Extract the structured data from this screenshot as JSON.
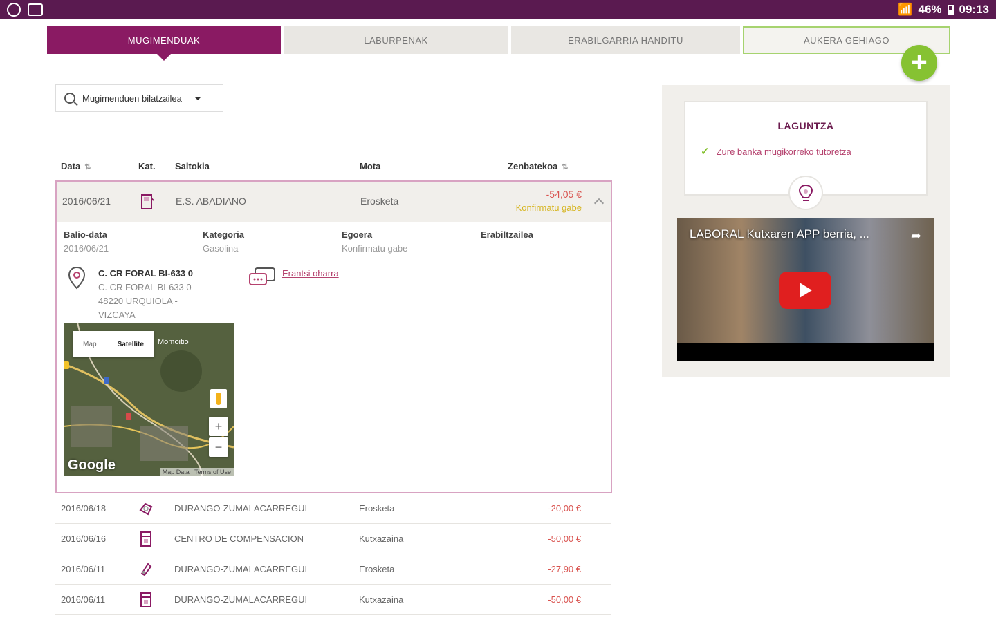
{
  "status_bar": {
    "battery": "46%",
    "time": "09:13"
  },
  "tabs": [
    {
      "label": "MUGIMENDUAK",
      "active": true
    },
    {
      "label": "LABURPENAK",
      "active": false
    },
    {
      "label": "ERABILGARRIA HANDITU",
      "active": false
    },
    {
      "label": "AUKERA GEHIAGO",
      "active": false
    }
  ],
  "fab": {
    "label": "+"
  },
  "search": {
    "label": "Mugimenduen bilatzailea"
  },
  "table": {
    "headers": {
      "date": "Data",
      "category": "Kat.",
      "store": "Saltokia",
      "type": "Mota",
      "amount": "Zenbatekoa"
    }
  },
  "expanded": {
    "date": "2016/06/21",
    "store": "E.S. ABADIANO",
    "type": "Erosketa",
    "amount": "-54,05 €",
    "status_note": "Konfirmatu gabe",
    "details": {
      "value_date_label": "Balio-data",
      "value_date": "2016/06/21",
      "category_label": "Kategoria",
      "category": "Gasolina",
      "state_label": "Egoera",
      "state": "Konfirmatu gabe",
      "user_label": "Erabiltzailea"
    },
    "address": {
      "title": "C. CR FORAL BI-633 0",
      "line1": "C. CR FORAL BI-633 0",
      "line2": "48220 URQUIOLA -",
      "line3": "VIZCAYA"
    },
    "send_note": "Erantsi oharra",
    "map": {
      "map_label": "Map",
      "satellite_label": "Satellite",
      "place": "Momoitio",
      "zoom_in": "+",
      "zoom_out": "−",
      "google": "Google",
      "legal": "Map Data | Terms of Use"
    }
  },
  "rows": [
    {
      "date": "2016/06/18",
      "store": "DURANGO-ZUMALACARREGUI",
      "type": "Erosketa",
      "amount": "-20,00 €"
    },
    {
      "date": "2016/06/16",
      "store": "CENTRO DE COMPENSACION",
      "type": "Kutxazaina",
      "amount": "-50,00 €"
    },
    {
      "date": "2016/06/11",
      "store": "DURANGO-ZUMALACARREGUI",
      "type": "Erosketa",
      "amount": "-27,90 €"
    },
    {
      "date": "2016/06/11",
      "store": "DURANGO-ZUMALACARREGUI",
      "type": "Kutxazaina",
      "amount": "-50,00 €"
    }
  ],
  "side": {
    "help_title": "LAGUNTZA",
    "help_link": "Zure banka mugikorreko tutoretza",
    "video_title": "LABORAL Kutxaren APP berria, ..."
  },
  "colors": {
    "brand": "#8a1a63",
    "status_bar": "#5a1a50",
    "accent_green": "#86c232",
    "amount_red": "#d9534f",
    "pending_yellow": "#d6b520"
  }
}
